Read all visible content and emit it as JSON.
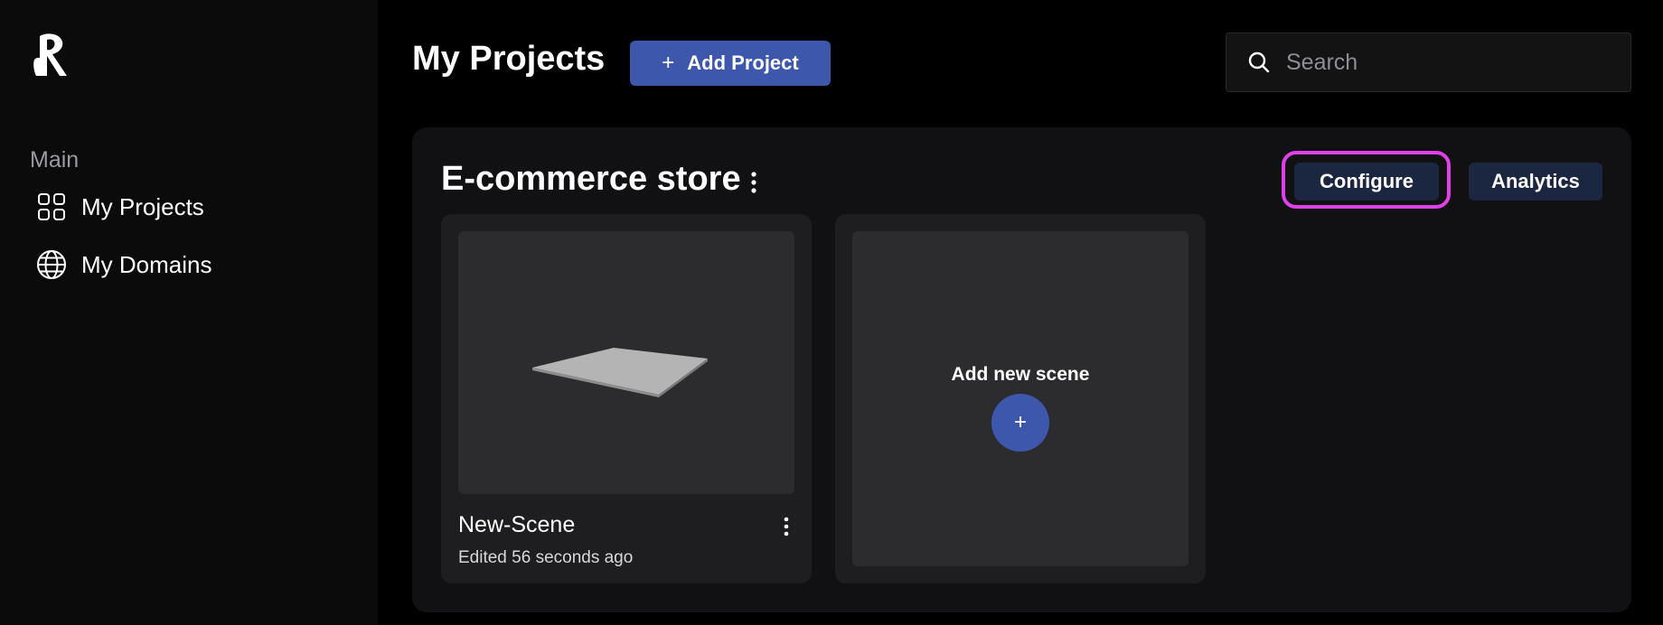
{
  "sidebar": {
    "logo_icon": "r-logo-icon",
    "section_label": "Main",
    "items": [
      {
        "label": "My Projects",
        "icon": "grid-icon"
      },
      {
        "label": "My Domains",
        "icon": "globe-icon"
      }
    ]
  },
  "header": {
    "title": "My Projects",
    "add_project_label": "Add Project",
    "search_placeholder": "Search",
    "search_value": ""
  },
  "project": {
    "name": "E-commerce store",
    "configure_label": "Configure",
    "analytics_label": "Analytics",
    "highlight_color": "#e040e8",
    "scenes": [
      {
        "name": "New-Scene",
        "edited": "Edited 56 seconds ago"
      }
    ],
    "add_scene_label": "Add new scene",
    "add_scene_button": "+"
  },
  "colors": {
    "accent": "#3d57ad",
    "secondary_button": "#1b2640",
    "panel": "#111113",
    "card": "#1e1e20"
  }
}
